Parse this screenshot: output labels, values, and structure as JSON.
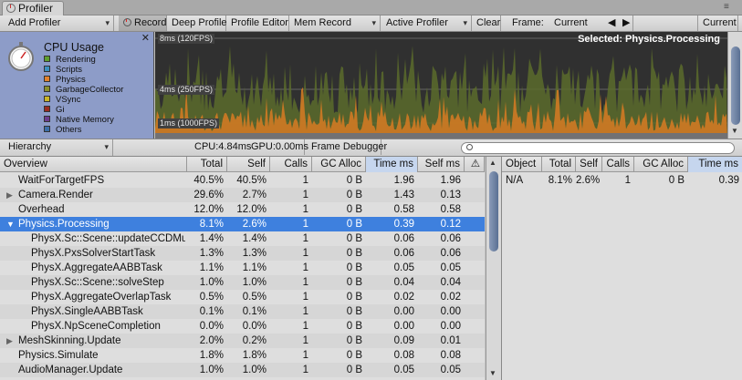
{
  "window": {
    "tab_title": "Profiler"
  },
  "toolbar": {
    "add_profiler": "Add Profiler",
    "record": "Record",
    "deep_profile": "Deep Profile",
    "profile_editor": "Profile Editor",
    "mem_record": "Mem Record",
    "active_profiler": "Active Profiler",
    "clear": "Clear",
    "frame_label": "Frame:",
    "frame_value": "Current",
    "current": "Current"
  },
  "cpu": {
    "title": "CPU Usage",
    "legend": [
      {
        "label": "Rendering",
        "color": "#5e9e2e"
      },
      {
        "label": "Scripts",
        "color": "#3b8fbf"
      },
      {
        "label": "Physics",
        "color": "#e2812c"
      },
      {
        "label": "GarbageCollector",
        "color": "#8a8f2e"
      },
      {
        "label": "VSync",
        "color": "#c9b428"
      },
      {
        "label": "Gi",
        "color": "#9a2c22"
      },
      {
        "label": "Native Memory",
        "color": "#6b3d8f"
      },
      {
        "label": "Others",
        "color": "#3c6ea8"
      }
    ],
    "graph_labels": [
      "8ms (120FPS)",
      "4ms (250FPS)",
      "1ms (1000FPS)"
    ],
    "selected": "Selected: Physics.Processing"
  },
  "toolbar2": {
    "view": "Hierarchy",
    "cpu": "CPU:4.84ms",
    "gpu": "GPU:0.00ms",
    "frame_debugger": "Frame Debugger"
  },
  "overview": {
    "headers": [
      "Overview",
      "Total",
      "Self",
      "Calls",
      "GC Alloc",
      "Time ms",
      "Self ms",
      "⚠"
    ],
    "rows": [
      {
        "name": "WaitForTargetFPS",
        "total": "40.5%",
        "self": "40.5%",
        "calls": "1",
        "gc": "0 B",
        "time": "1.96",
        "selfms": "1.96",
        "indent": 0,
        "arrow": ""
      },
      {
        "name": "Camera.Render",
        "total": "29.6%",
        "self": "2.7%",
        "calls": "1",
        "gc": "0 B",
        "time": "1.43",
        "selfms": "0.13",
        "indent": 0,
        "arrow": "▶"
      },
      {
        "name": "Overhead",
        "total": "12.0%",
        "self": "12.0%",
        "calls": "1",
        "gc": "0 B",
        "time": "0.58",
        "selfms": "0.58",
        "indent": 0,
        "arrow": ""
      },
      {
        "name": "Physics.Processing",
        "total": "8.1%",
        "self": "2.6%",
        "calls": "1",
        "gc": "0 B",
        "time": "0.39",
        "selfms": "0.12",
        "indent": 0,
        "arrow": "▼",
        "selected": true
      },
      {
        "name": "PhysX.Sc::Scene::updateCCDMu",
        "total": "1.4%",
        "self": "1.4%",
        "calls": "1",
        "gc": "0 B",
        "time": "0.06",
        "selfms": "0.06",
        "indent": 1,
        "arrow": ""
      },
      {
        "name": "PhysX.PxsSolverStartTask",
        "total": "1.3%",
        "self": "1.3%",
        "calls": "1",
        "gc": "0 B",
        "time": "0.06",
        "selfms": "0.06",
        "indent": 1,
        "arrow": ""
      },
      {
        "name": "PhysX.AggregateAABBTask",
        "total": "1.1%",
        "self": "1.1%",
        "calls": "1",
        "gc": "0 B",
        "time": "0.05",
        "selfms": "0.05",
        "indent": 1,
        "arrow": ""
      },
      {
        "name": "PhysX.Sc::Scene::solveStep",
        "total": "1.0%",
        "self": "1.0%",
        "calls": "1",
        "gc": "0 B",
        "time": "0.04",
        "selfms": "0.04",
        "indent": 1,
        "arrow": ""
      },
      {
        "name": "PhysX.AggregateOverlapTask",
        "total": "0.5%",
        "self": "0.5%",
        "calls": "1",
        "gc": "0 B",
        "time": "0.02",
        "selfms": "0.02",
        "indent": 1,
        "arrow": ""
      },
      {
        "name": "PhysX.SingleAABBTask",
        "total": "0.1%",
        "self": "0.1%",
        "calls": "1",
        "gc": "0 B",
        "time": "0.00",
        "selfms": "0.00",
        "indent": 1,
        "arrow": ""
      },
      {
        "name": "PhysX.NpSceneCompletion",
        "total": "0.0%",
        "self": "0.0%",
        "calls": "1",
        "gc": "0 B",
        "time": "0.00",
        "selfms": "0.00",
        "indent": 1,
        "arrow": ""
      },
      {
        "name": "MeshSkinning.Update",
        "total": "2.0%",
        "self": "0.2%",
        "calls": "1",
        "gc": "0 B",
        "time": "0.09",
        "selfms": "0.01",
        "indent": 0,
        "arrow": "▶"
      },
      {
        "name": "Physics.Simulate",
        "total": "1.8%",
        "self": "1.8%",
        "calls": "1",
        "gc": "0 B",
        "time": "0.08",
        "selfms": "0.08",
        "indent": 0,
        "arrow": ""
      },
      {
        "name": "AudioManager.Update",
        "total": "1.0%",
        "self": "1.0%",
        "calls": "1",
        "gc": "0 B",
        "time": "0.05",
        "selfms": "0.05",
        "indent": 0,
        "arrow": ""
      }
    ]
  },
  "objects": {
    "headers": [
      "Object",
      "Total",
      "Self",
      "Calls",
      "GC Alloc",
      "Time ms"
    ],
    "rows": [
      {
        "name": "N/A",
        "total": "8.1%",
        "self": "2.6%",
        "calls": "1",
        "gc": "0 B",
        "time": "0.39"
      }
    ]
  }
}
